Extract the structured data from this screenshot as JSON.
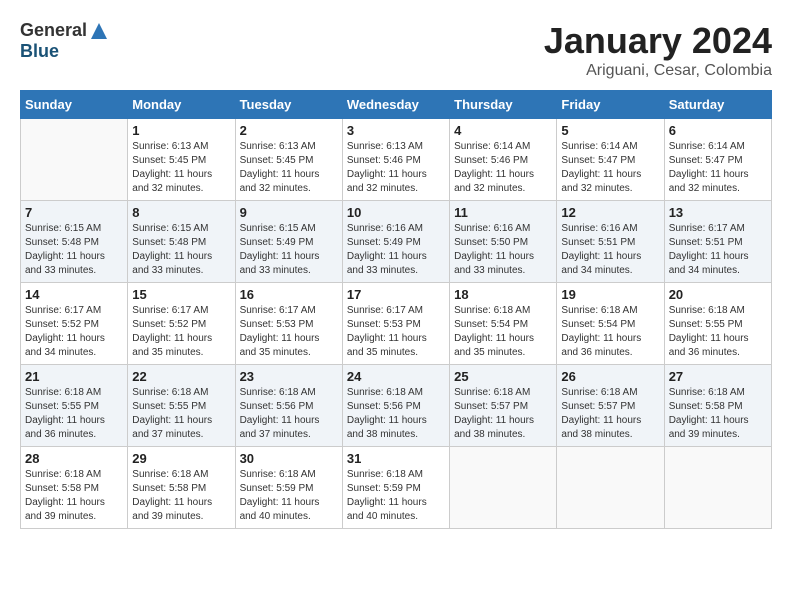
{
  "header": {
    "logo_general": "General",
    "logo_blue": "Blue",
    "month_title": "January 2024",
    "subtitle": "Ariguani, Cesar, Colombia"
  },
  "calendar": {
    "days_of_week": [
      "Sunday",
      "Monday",
      "Tuesday",
      "Wednesday",
      "Thursday",
      "Friday",
      "Saturday"
    ],
    "weeks": [
      [
        {
          "day": "",
          "sunrise": "",
          "sunset": "",
          "daylight": ""
        },
        {
          "day": "1",
          "sunrise": "Sunrise: 6:13 AM",
          "sunset": "Sunset: 5:45 PM",
          "daylight": "Daylight: 11 hours and 32 minutes."
        },
        {
          "day": "2",
          "sunrise": "Sunrise: 6:13 AM",
          "sunset": "Sunset: 5:45 PM",
          "daylight": "Daylight: 11 hours and 32 minutes."
        },
        {
          "day": "3",
          "sunrise": "Sunrise: 6:13 AM",
          "sunset": "Sunset: 5:46 PM",
          "daylight": "Daylight: 11 hours and 32 minutes."
        },
        {
          "day": "4",
          "sunrise": "Sunrise: 6:14 AM",
          "sunset": "Sunset: 5:46 PM",
          "daylight": "Daylight: 11 hours and 32 minutes."
        },
        {
          "day": "5",
          "sunrise": "Sunrise: 6:14 AM",
          "sunset": "Sunset: 5:47 PM",
          "daylight": "Daylight: 11 hours and 32 minutes."
        },
        {
          "day": "6",
          "sunrise": "Sunrise: 6:14 AM",
          "sunset": "Sunset: 5:47 PM",
          "daylight": "Daylight: 11 hours and 32 minutes."
        }
      ],
      [
        {
          "day": "7",
          "sunrise": "Sunrise: 6:15 AM",
          "sunset": "Sunset: 5:48 PM",
          "daylight": "Daylight: 11 hours and 33 minutes."
        },
        {
          "day": "8",
          "sunrise": "Sunrise: 6:15 AM",
          "sunset": "Sunset: 5:48 PM",
          "daylight": "Daylight: 11 hours and 33 minutes."
        },
        {
          "day": "9",
          "sunrise": "Sunrise: 6:15 AM",
          "sunset": "Sunset: 5:49 PM",
          "daylight": "Daylight: 11 hours and 33 minutes."
        },
        {
          "day": "10",
          "sunrise": "Sunrise: 6:16 AM",
          "sunset": "Sunset: 5:49 PM",
          "daylight": "Daylight: 11 hours and 33 minutes."
        },
        {
          "day": "11",
          "sunrise": "Sunrise: 6:16 AM",
          "sunset": "Sunset: 5:50 PM",
          "daylight": "Daylight: 11 hours and 33 minutes."
        },
        {
          "day": "12",
          "sunrise": "Sunrise: 6:16 AM",
          "sunset": "Sunset: 5:51 PM",
          "daylight": "Daylight: 11 hours and 34 minutes."
        },
        {
          "day": "13",
          "sunrise": "Sunrise: 6:17 AM",
          "sunset": "Sunset: 5:51 PM",
          "daylight": "Daylight: 11 hours and 34 minutes."
        }
      ],
      [
        {
          "day": "14",
          "sunrise": "Sunrise: 6:17 AM",
          "sunset": "Sunset: 5:52 PM",
          "daylight": "Daylight: 11 hours and 34 minutes."
        },
        {
          "day": "15",
          "sunrise": "Sunrise: 6:17 AM",
          "sunset": "Sunset: 5:52 PM",
          "daylight": "Daylight: 11 hours and 35 minutes."
        },
        {
          "day": "16",
          "sunrise": "Sunrise: 6:17 AM",
          "sunset": "Sunset: 5:53 PM",
          "daylight": "Daylight: 11 hours and 35 minutes."
        },
        {
          "day": "17",
          "sunrise": "Sunrise: 6:17 AM",
          "sunset": "Sunset: 5:53 PM",
          "daylight": "Daylight: 11 hours and 35 minutes."
        },
        {
          "day": "18",
          "sunrise": "Sunrise: 6:18 AM",
          "sunset": "Sunset: 5:54 PM",
          "daylight": "Daylight: 11 hours and 35 minutes."
        },
        {
          "day": "19",
          "sunrise": "Sunrise: 6:18 AM",
          "sunset": "Sunset: 5:54 PM",
          "daylight": "Daylight: 11 hours and 36 minutes."
        },
        {
          "day": "20",
          "sunrise": "Sunrise: 6:18 AM",
          "sunset": "Sunset: 5:55 PM",
          "daylight": "Daylight: 11 hours and 36 minutes."
        }
      ],
      [
        {
          "day": "21",
          "sunrise": "Sunrise: 6:18 AM",
          "sunset": "Sunset: 5:55 PM",
          "daylight": "Daylight: 11 hours and 36 minutes."
        },
        {
          "day": "22",
          "sunrise": "Sunrise: 6:18 AM",
          "sunset": "Sunset: 5:55 PM",
          "daylight": "Daylight: 11 hours and 37 minutes."
        },
        {
          "day": "23",
          "sunrise": "Sunrise: 6:18 AM",
          "sunset": "Sunset: 5:56 PM",
          "daylight": "Daylight: 11 hours and 37 minutes."
        },
        {
          "day": "24",
          "sunrise": "Sunrise: 6:18 AM",
          "sunset": "Sunset: 5:56 PM",
          "daylight": "Daylight: 11 hours and 38 minutes."
        },
        {
          "day": "25",
          "sunrise": "Sunrise: 6:18 AM",
          "sunset": "Sunset: 5:57 PM",
          "daylight": "Daylight: 11 hours and 38 minutes."
        },
        {
          "day": "26",
          "sunrise": "Sunrise: 6:18 AM",
          "sunset": "Sunset: 5:57 PM",
          "daylight": "Daylight: 11 hours and 38 minutes."
        },
        {
          "day": "27",
          "sunrise": "Sunrise: 6:18 AM",
          "sunset": "Sunset: 5:58 PM",
          "daylight": "Daylight: 11 hours and 39 minutes."
        }
      ],
      [
        {
          "day": "28",
          "sunrise": "Sunrise: 6:18 AM",
          "sunset": "Sunset: 5:58 PM",
          "daylight": "Daylight: 11 hours and 39 minutes."
        },
        {
          "day": "29",
          "sunrise": "Sunrise: 6:18 AM",
          "sunset": "Sunset: 5:58 PM",
          "daylight": "Daylight: 11 hours and 39 minutes."
        },
        {
          "day": "30",
          "sunrise": "Sunrise: 6:18 AM",
          "sunset": "Sunset: 5:59 PM",
          "daylight": "Daylight: 11 hours and 40 minutes."
        },
        {
          "day": "31",
          "sunrise": "Sunrise: 6:18 AM",
          "sunset": "Sunset: 5:59 PM",
          "daylight": "Daylight: 11 hours and 40 minutes."
        },
        {
          "day": "",
          "sunrise": "",
          "sunset": "",
          "daylight": ""
        },
        {
          "day": "",
          "sunrise": "",
          "sunset": "",
          "daylight": ""
        },
        {
          "day": "",
          "sunrise": "",
          "sunset": "",
          "daylight": ""
        }
      ]
    ]
  }
}
